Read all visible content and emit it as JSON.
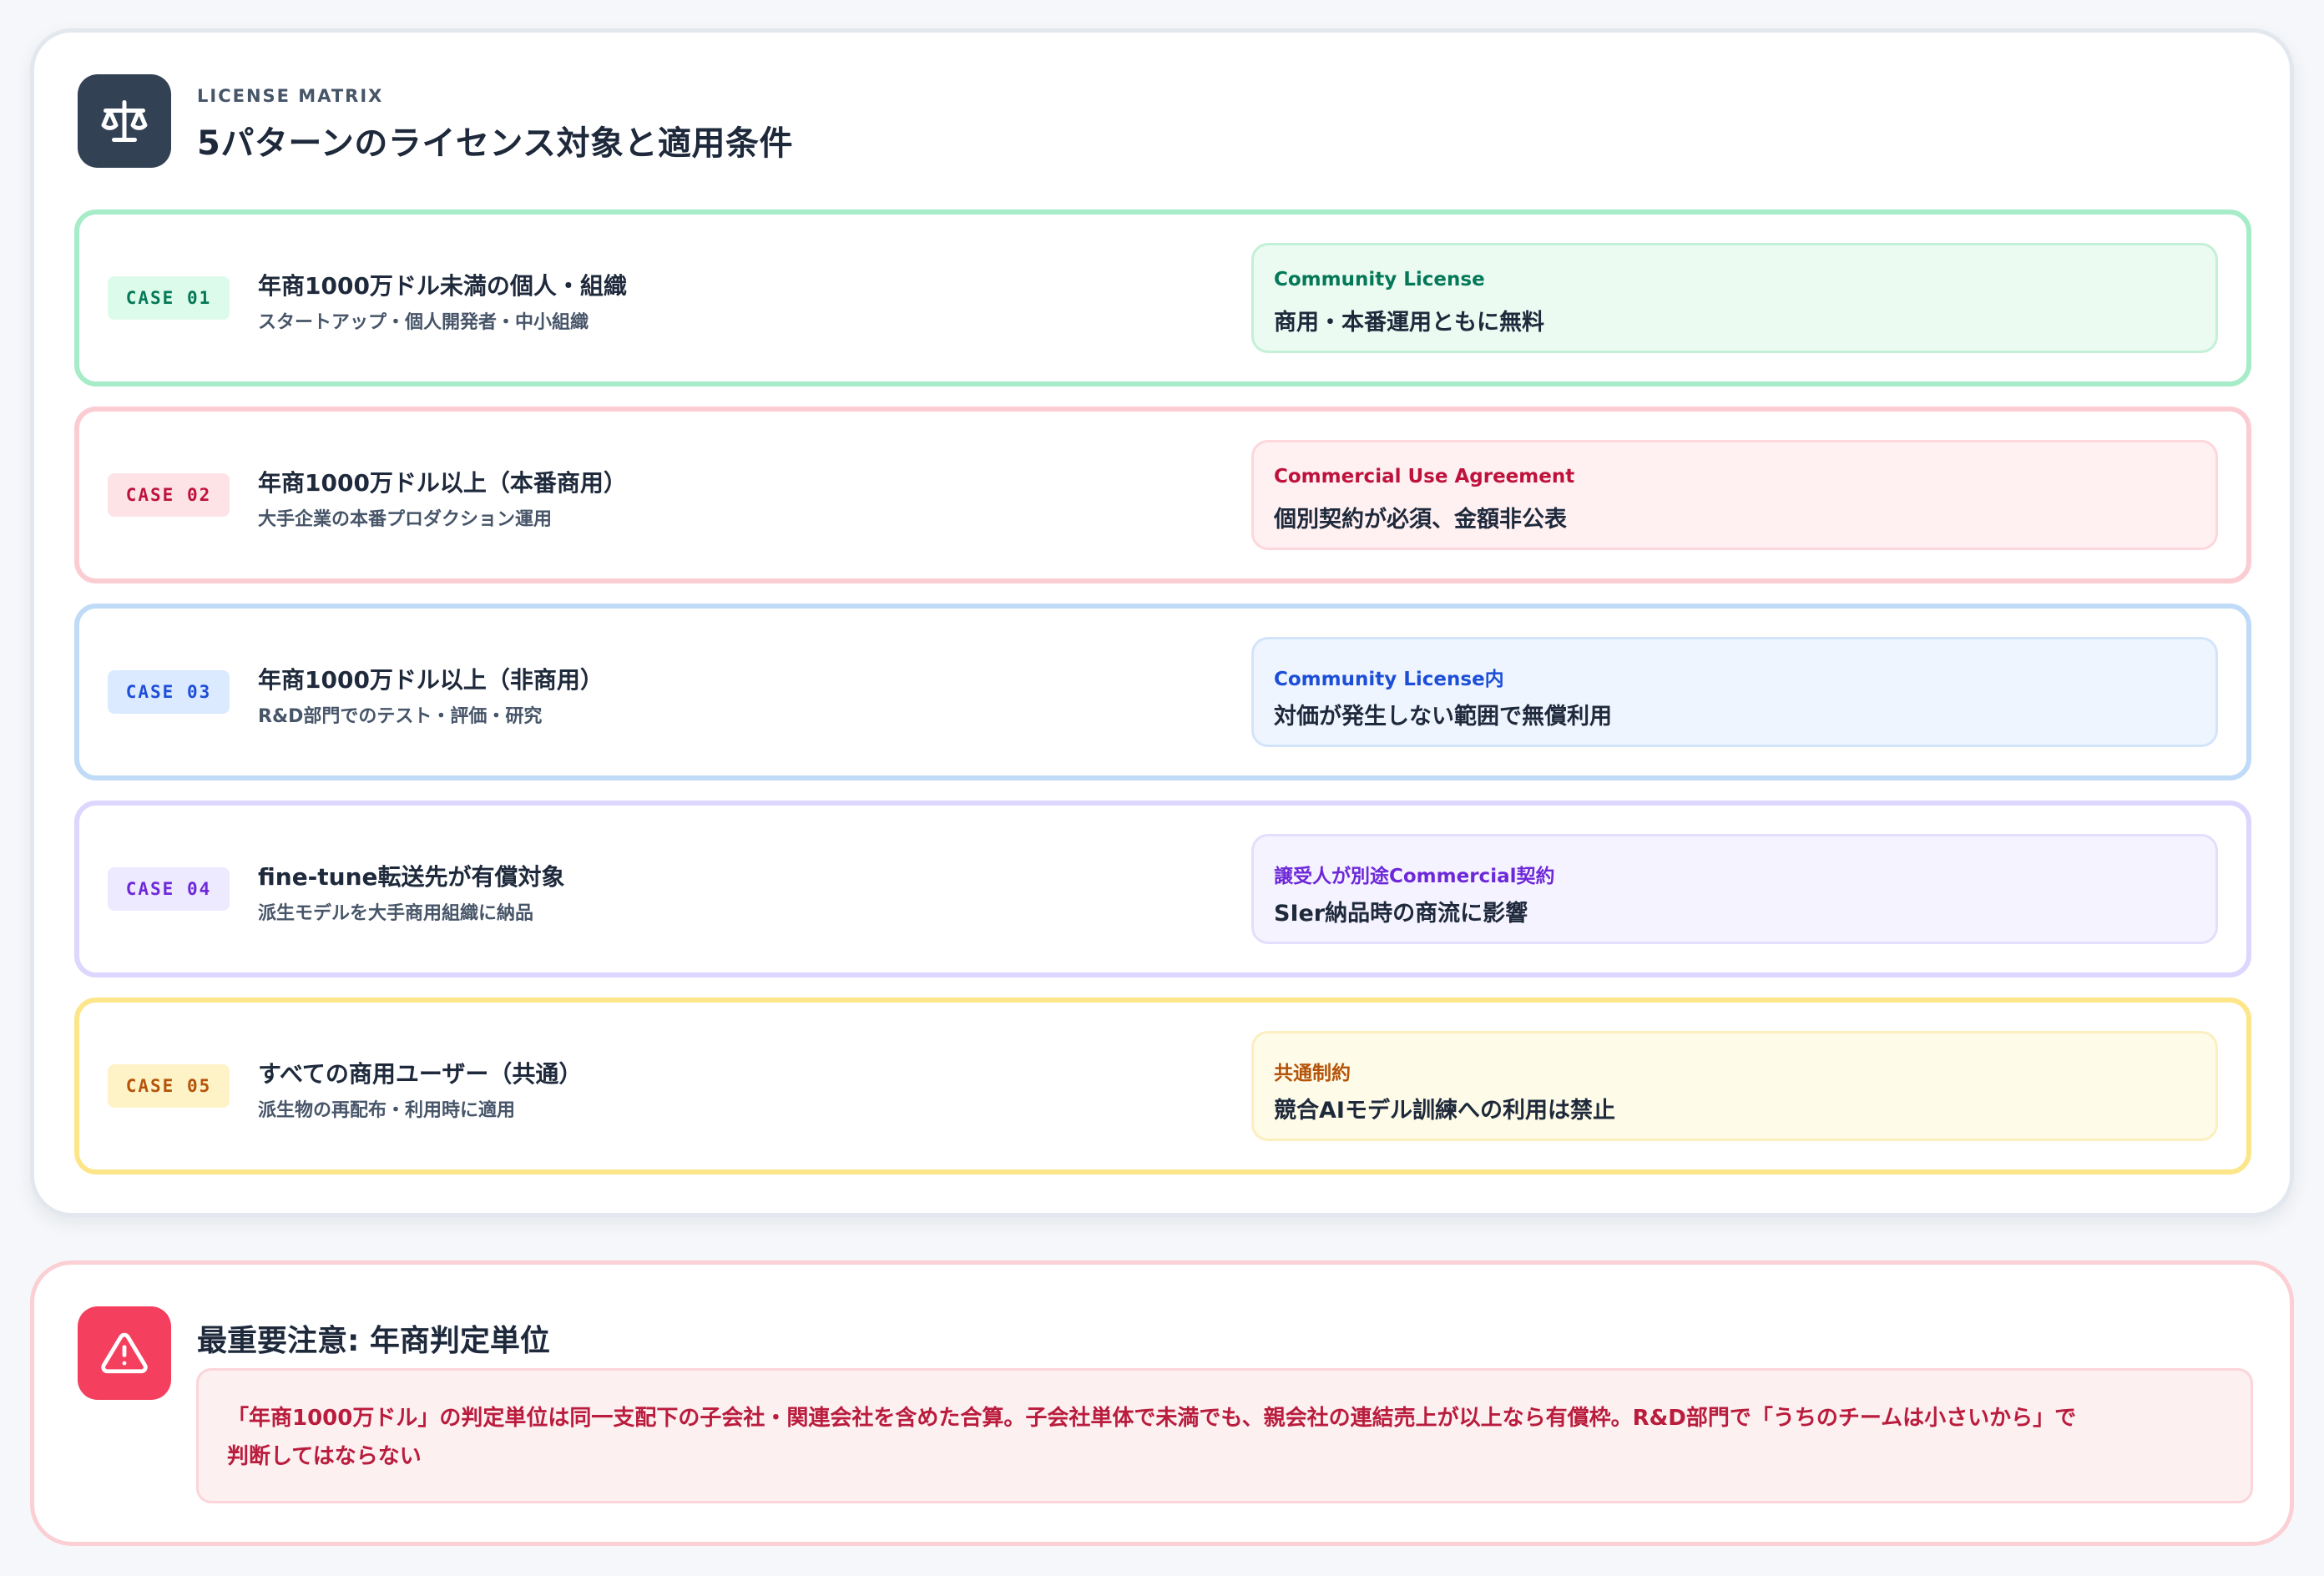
{
  "header": {
    "kicker": "LICENSE MATRIX",
    "title": "5パターンのライセンス対象と適用条件",
    "icon": "scale-icon"
  },
  "cases": [
    {
      "badge": "CASE 01",
      "title": "年商1000万ドル未満の個人・組織",
      "description": "スタートアップ・個人開発者・中小組織",
      "license_name": "Community License",
      "license_note": "商用・本番運用ともに無料",
      "colors": {
        "border": "#a7ecc8",
        "badge_bg": "#dcfbea",
        "badge_text": "#047857",
        "box_bg": "#ebfbf2",
        "box_border": "#c3f0d7",
        "name_text": "#047857"
      }
    },
    {
      "badge": "CASE 02",
      "title": "年商1000万ドル以上（本番商用）",
      "description": "大手企業の本番プロダクション運用",
      "license_name": "Commercial Use Agreement",
      "license_note": "個別契約が必須、金額非公表",
      "colors": {
        "border": "#fbcdd3",
        "badge_bg": "#fde3e6",
        "badge_text": "#be123c",
        "box_bg": "#fff1f2",
        "box_border": "#fcd7dc",
        "name_text": "#be123c"
      }
    },
    {
      "badge": "CASE 03",
      "title": "年商1000万ドル以上（非商用）",
      "description": "R&D部門でのテスト・評価・研究",
      "license_name": "Community License内",
      "license_note": "対価が発生しない範囲で無償利用",
      "colors": {
        "border": "#bfdbf7",
        "badge_bg": "#dbeafe",
        "badge_text": "#1d4ed8",
        "box_bg": "#eef5ff",
        "box_border": "#d3e4fa",
        "name_text": "#1d4ed8"
      }
    },
    {
      "badge": "CASE 04",
      "title": "fine-tune転送先が有償対象",
      "description": "派生モデルを大手商用組織に納品",
      "license_name": "譲受人が別途Commercial契約",
      "license_note": "SIer納品時の商流に影響",
      "colors": {
        "border": "#ddd6fe",
        "badge_bg": "#ede9fe",
        "badge_text": "#6d28d9",
        "box_bg": "#f5f3ff",
        "box_border": "#e4defd",
        "name_text": "#6d28d9"
      }
    },
    {
      "badge": "CASE 05",
      "title": "すべての商用ユーザー（共通）",
      "description": "派生物の再配布・利用時に適用",
      "license_name": "共通制約",
      "license_note": "競合AIモデル訓練への利用は禁止",
      "colors": {
        "border": "#fde68a",
        "badge_bg": "#fef3c7",
        "badge_text": "#b45309",
        "box_bg": "#fefbe8",
        "box_border": "#fbefc0",
        "name_text": "#b45309"
      }
    }
  ],
  "warning": {
    "icon": "alert-triangle-icon",
    "title": "最重要注意: 年商判定単位",
    "body_line1": "「年商1000万ドル」の判定単位は同一支配下の子会社・関連会社を含めた合算。子会社単体で未満でも、親会社の連結売上が以上なら有償枠。R&D部門で「うちのチームは小さいから」で",
    "body_line2": "判断してはならない"
  }
}
